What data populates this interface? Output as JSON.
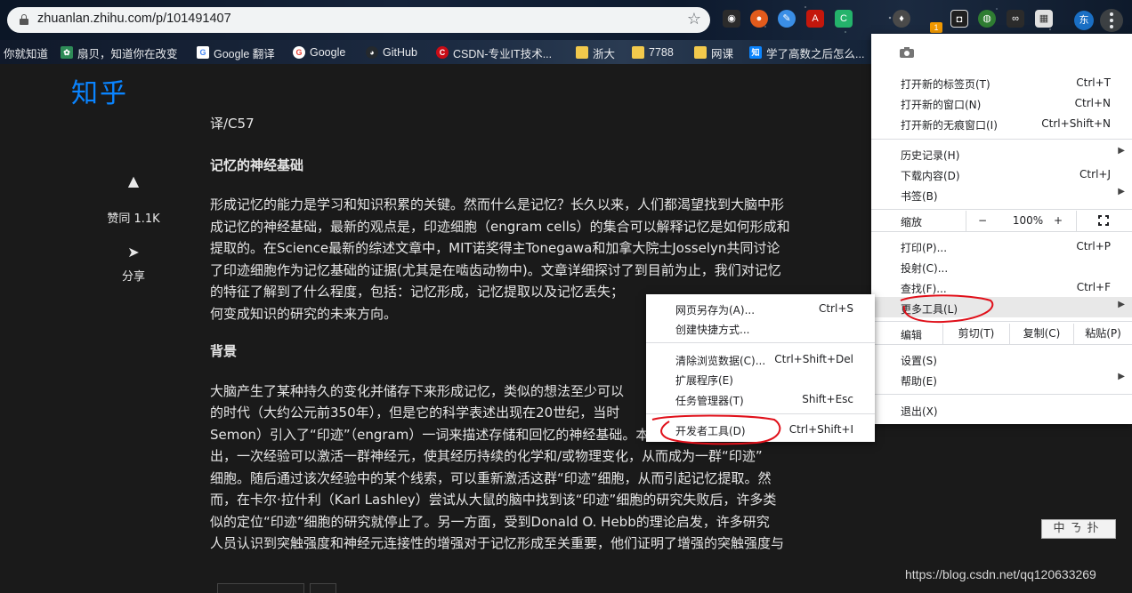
{
  "browser": {
    "url": "zhuanlan.zhihu.com/p/101491407",
    "extension_badge": "1",
    "avatar_letter": "东"
  },
  "bookmarks": [
    {
      "label": "你就知道",
      "icon": ""
    },
    {
      "label": "扇贝，知道你在改变",
      "icon": "shanbay-icon",
      "color": "#2e8b57"
    },
    {
      "label": "Google 翻译",
      "icon": "google-translate-icon",
      "color": "#ffffff"
    },
    {
      "label": "Google",
      "icon": "google-icon",
      "color": "#ffffff"
    },
    {
      "label": "GitHub",
      "icon": "github-icon",
      "color": "#24292e"
    },
    {
      "label": "CSDN-专业IT技术...",
      "icon": "csdn-icon",
      "color": "#ca0c16"
    },
    {
      "label": "浙大",
      "icon": "folder-icon",
      "color": "#f2c94c"
    },
    {
      "label": "7788",
      "icon": "folder-icon",
      "color": "#f2c94c"
    },
    {
      "label": "网课",
      "icon": "folder-icon",
      "color": "#f2c94c"
    },
    {
      "label": "学了高数之后怎么...",
      "icon": "zhihu-icon",
      "color": "#0a84ff"
    }
  ],
  "page": {
    "logo": "知乎",
    "vote_label": "赞同 1.1K",
    "share_label": "分享",
    "translator": "译/C57",
    "heading1": "记忆的神经基础",
    "para1_lines": [
      "形成记忆的能力是学习和知识积累的关键。然而什么是记忆？长久以来，人们都渴望找到大脑中形",
      "成记忆的神经基础，最新的观点是，印迹细胞（engram cells）的集合可以解释记忆是如何形成和",
      "提取的。在Science最新的综述文章中，MIT诺奖得主Tonegawa和加拿大院士Josselyn共同讨论",
      "了印迹细胞作为记忆基础的证据(尤其是在啮齿动物中)。文章详细探讨了到目前为止，我们对记忆",
      "的特征了解到了什么程度，包括：记忆形成，记忆提取以及记忆丢失；",
      "何变成知识的研究的未来方向。"
    ],
    "heading2": "背景",
    "para2_lines": [
      "大脑产生了某种持久的变化并储存下来形成记忆，类似的想法至少可以",
      "的时代（大约公元前350年），但是它的科学表述出现在20世纪，当时",
      "Semon）引入了“印迹”（engram）一词来描述存储和回忆的神经基础。本质上，Semon提",
      "出，一次经验可以激活一群神经元，使其经历持续的化学和/或物理变化，从而成为一群“印迹”",
      "细胞。随后通过该次经验中的某个线索，可以重新激活这群“印迹”细胞，从而引起记忆提取。然",
      "而，在卡尔·拉什利（Karl Lashley）尝试从大鼠的脑中找到该“印迹”细胞的研究失败后，许多类",
      "似的定位“印迹”细胞的研究就停止了。另一方面，受到Donald O. Hebb的理论启发，许多研究",
      "人员认识到突触强度和神经元连接性的增强对于记忆形成至关重要，他们证明了增强的突触强度与"
    ],
    "ime_text": "中ㄋ扑",
    "watermark": "https://blog.csdn.net/qq120633269"
  },
  "menu": {
    "new_tab": {
      "label": "打开新的标签页(T)",
      "shortcut": "Ctrl+T"
    },
    "new_window": {
      "label": "打开新的窗口(N)",
      "shortcut": "Ctrl+N"
    },
    "incognito": {
      "label": "打开新的无痕窗口(I)",
      "shortcut": "Ctrl+Shift+N"
    },
    "history": {
      "label": "历史记录(H)"
    },
    "downloads": {
      "label": "下载内容(D)",
      "shortcut": "Ctrl+J"
    },
    "bookmarks": {
      "label": "书签(B)"
    },
    "zoom": {
      "label": "缩放",
      "minus": "−",
      "value": "100%",
      "plus": "+"
    },
    "print": {
      "label": "打印(P)...",
      "shortcut": "Ctrl+P"
    },
    "cast": {
      "label": "投射(C)..."
    },
    "find": {
      "label": "查找(F)...",
      "shortcut": "Ctrl+F"
    },
    "more_tools": {
      "label": "更多工具(L)"
    },
    "edit": {
      "label": "编辑",
      "cut": "剪切(T)",
      "copy": "复制(C)",
      "paste": "粘贴(P)"
    },
    "settings": {
      "label": "设置(S)"
    },
    "help": {
      "label": "帮助(E)"
    },
    "exit": {
      "label": "退出(X)"
    }
  },
  "submenu": {
    "save_page": {
      "label": "网页另存为(A)...",
      "shortcut": "Ctrl+S"
    },
    "create_shortcut": {
      "label": "创建快捷方式..."
    },
    "clear_data": {
      "label": "清除浏览数据(C)...",
      "shortcut": "Ctrl+Shift+Del"
    },
    "extensions": {
      "label": "扩展程序(E)"
    },
    "task_manager": {
      "label": "任务管理器(T)",
      "shortcut": "Shift+Esc"
    },
    "dev_tools": {
      "label": "开发者工具(D)",
      "shortcut": "Ctrl+Shift+I"
    }
  },
  "colors": {
    "annotation": "#e0101a",
    "menu_hover": "#e8e8e8",
    "zhihu_blue": "#0a84ff"
  }
}
